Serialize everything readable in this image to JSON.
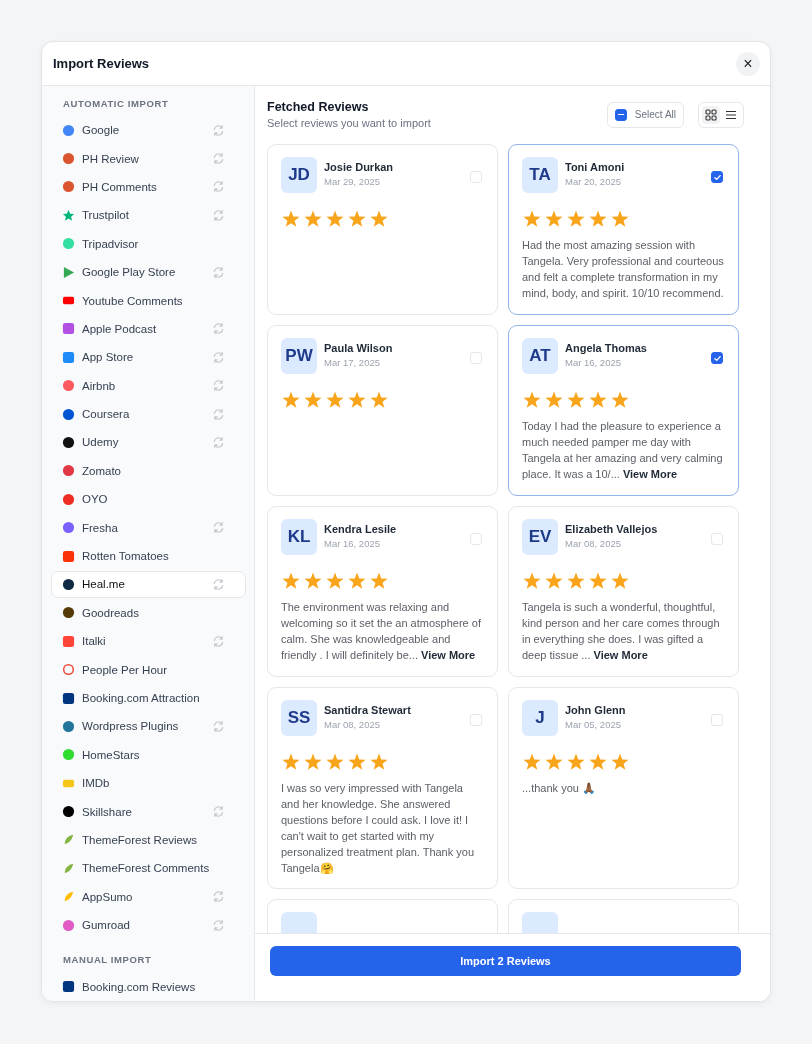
{
  "dialog": {
    "title": "Import Reviews",
    "close": "×"
  },
  "sidebar": {
    "sections": [
      {
        "heading": "AUTOMATIC IMPORT",
        "items": [
          {
            "label": "Google",
            "sync": true,
            "selected": false
          },
          {
            "label": "PH Review",
            "sync": true,
            "selected": false
          },
          {
            "label": "PH Comments",
            "sync": true,
            "selected": false
          },
          {
            "label": "Trustpilot",
            "sync": true,
            "selected": false
          },
          {
            "label": "Tripadvisor",
            "sync": false,
            "selected": false
          },
          {
            "label": "Google Play Store",
            "sync": true,
            "selected": false
          },
          {
            "label": "Youtube Comments",
            "sync": false,
            "selected": false
          },
          {
            "label": "Apple Podcast",
            "sync": true,
            "selected": false
          },
          {
            "label": "App Store",
            "sync": true,
            "selected": false
          },
          {
            "label": "Airbnb",
            "sync": true,
            "selected": false
          },
          {
            "label": "Coursera",
            "sync": true,
            "selected": false
          },
          {
            "label": "Udemy",
            "sync": true,
            "selected": false
          },
          {
            "label": "Zomato",
            "sync": false,
            "selected": false
          },
          {
            "label": "OYO",
            "sync": false,
            "selected": false
          },
          {
            "label": "Fresha",
            "sync": true,
            "selected": false
          },
          {
            "label": "Rotten Tomatoes",
            "sync": false,
            "selected": false
          },
          {
            "label": "Heal.me",
            "sync": true,
            "selected": true
          },
          {
            "label": "Goodreads",
            "sync": false,
            "selected": false
          },
          {
            "label": "Italki",
            "sync": true,
            "selected": false
          },
          {
            "label": "People Per Hour",
            "sync": false,
            "selected": false
          },
          {
            "label": "Booking.com Attraction",
            "sync": false,
            "selected": false
          },
          {
            "label": "Wordpress Plugins",
            "sync": true,
            "selected": false
          },
          {
            "label": "HomeStars",
            "sync": false,
            "selected": false
          },
          {
            "label": "IMDb",
            "sync": false,
            "selected": false
          },
          {
            "label": "Skillshare",
            "sync": true,
            "selected": false
          },
          {
            "label": "ThemeForest Reviews",
            "sync": false,
            "selected": false
          },
          {
            "label": "ThemeForest Comments",
            "sync": false,
            "selected": false
          },
          {
            "label": "AppSumo",
            "sync": true,
            "selected": false
          },
          {
            "label": "Gumroad",
            "sync": true,
            "selected": false
          }
        ]
      },
      {
        "heading": "MANUAL IMPORT",
        "items": [
          {
            "label": "Booking.com Reviews",
            "sync": false,
            "selected": false
          }
        ]
      }
    ]
  },
  "main": {
    "title": "Fetched Reviews",
    "subtitle": "Select reviews you want to import",
    "select_all": {
      "label": "Select All",
      "indeterminate": true
    },
    "view_modes": [
      {
        "kind": "grid",
        "selected": true
      },
      {
        "kind": "list",
        "selected": false
      }
    ],
    "reviews": [
      {
        "kind": "review",
        "initials": "JD",
        "name": "Josie Durkan",
        "date": "Mar 29, 2025",
        "stars": 5,
        "selected": false
      },
      {
        "kind": "review",
        "initials": "TA",
        "name": "Toni Amoni",
        "date": "Mar 20, 2025",
        "stars": 5,
        "selected": true,
        "text": "Had the most amazing session with Tangela. Very professional and courteous and felt a complete transformation in my mind, body, and spirit. 10/10 recommend."
      },
      {
        "kind": "review",
        "initials": "PW",
        "name": "Paula Wilson",
        "date": "Mar 17, 2025",
        "stars": 5,
        "selected": false
      },
      {
        "kind": "review",
        "initials": "AT",
        "name": "Angela Thomas",
        "date": "Mar 16, 2025",
        "stars": 5,
        "selected": true,
        "text": "Today I had the pleasure to experience a much needed pamper me day with Tangela at her amazing and very calming place. It was a 10/...",
        "more": "View More"
      },
      {
        "kind": "review",
        "initials": "KL",
        "name": "Kendra Lesile",
        "date": "Mar 16, 2025",
        "stars": 5,
        "selected": false,
        "text": "The environment was relaxing and welcoming so it set the an atmosphere of calm. She was knowledgeable and friendly . I will definitely be...",
        "more": "View More"
      },
      {
        "kind": "review",
        "initials": "EV",
        "name": "Elizabeth Vallejos",
        "date": "Mar 08, 2025",
        "stars": 5,
        "selected": false,
        "text": "Tangela is such a wonderful, thoughtful, kind person and her care comes through in everything she does. I was gifted a deep tissue ...",
        "more": "View More"
      },
      {
        "kind": "review",
        "initials": "SS",
        "name": "Santidra Stewart",
        "date": "Mar 08, 2025",
        "stars": 5,
        "selected": false,
        "text": "I was so very impressed with Tangela and her knowledge. She answered questions before I could ask. I love it! I can't wait to get started with my personalized treatment plan. Thank you Tangela🤗"
      },
      {
        "kind": "review",
        "initials": "J",
        "name": "John Glenn",
        "date": "Mar 05, 2025",
        "stars": 5,
        "selected": false,
        "text": "...thank you 🙏🏾"
      },
      {
        "kind": "partial"
      },
      {
        "kind": "partial"
      }
    ],
    "import_button": "Import 2 Reviews"
  }
}
